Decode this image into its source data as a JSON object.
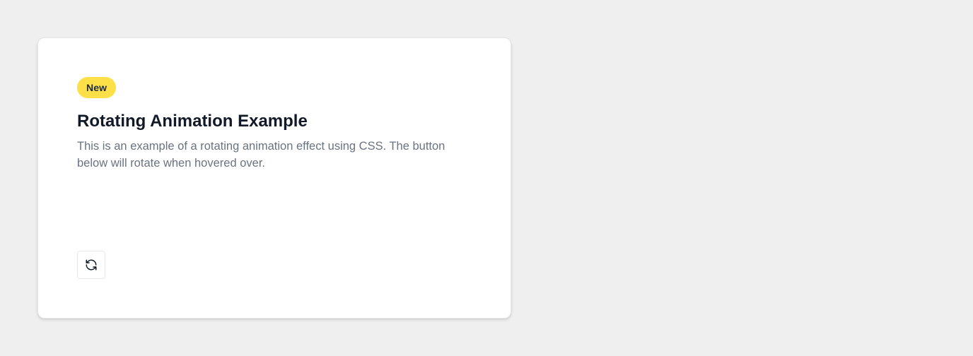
{
  "card": {
    "badge": "New",
    "title": "Rotating Animation Example",
    "description": "This is an example of a rotating animation effect using CSS. The button below will rotate when hovered over.",
    "button": {
      "icon": "refresh-icon"
    }
  },
  "colors": {
    "background": "#efefef",
    "card": "#ffffff",
    "badge": "#fde047",
    "title": "#111827",
    "description": "#6b7280"
  }
}
